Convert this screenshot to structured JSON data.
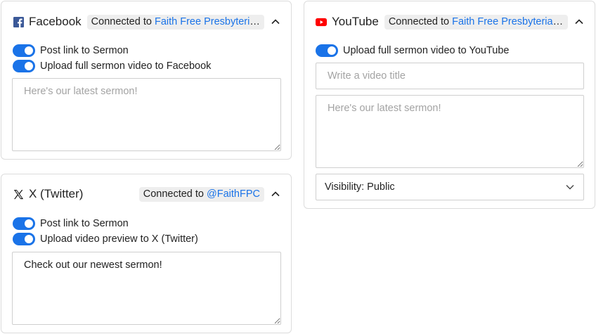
{
  "facebook": {
    "name": "Facebook",
    "connected_prefix": "Connected to ",
    "connected_target": "Faith Free Presbyterian Church",
    "toggles": [
      {
        "label": "Post link to Sermon",
        "on": true
      },
      {
        "label": "Upload full sermon video to Facebook",
        "on": true
      }
    ],
    "message_placeholder": "Here's our latest sermon!",
    "icon": "facebook-icon",
    "color": "#3b5998"
  },
  "twitter": {
    "name": "X (Twitter)",
    "connected_prefix": "Connected to ",
    "connected_target": "@FaithFPC",
    "toggles": [
      {
        "label": "Post link to Sermon",
        "on": true
      },
      {
        "label": "Upload video preview to X (Twitter)",
        "on": true
      }
    ],
    "message_value": "Check out our newest sermon!",
    "icon": "x-logo-icon",
    "color": "#000000"
  },
  "youtube": {
    "name": "YouTube",
    "connected_prefix": "Connected to ",
    "connected_target": "Faith Free Presbyterian Church",
    "toggles": [
      {
        "label": "Upload full sermon video to YouTube",
        "on": true
      }
    ],
    "title_placeholder": "Write a video title",
    "description_placeholder": "Here's our latest sermon!",
    "visibility_label": "Visibility: Public",
    "icon": "youtube-icon",
    "color": "#ff0000"
  },
  "theme": {
    "accent": "#1a73e8",
    "border": "#dcdcdc",
    "badge_bg": "#eeeeee"
  }
}
